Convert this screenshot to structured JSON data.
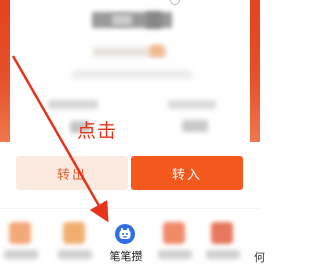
{
  "annotation": {
    "text": "点击"
  },
  "actions": {
    "transfer_out_label": "转出",
    "transfer_in_label": "转入"
  },
  "bottom_nav": {
    "active_label": "笔笔攒",
    "partial_right_char": "何"
  },
  "colors": {
    "header_red": "#e3431e",
    "primary_orange": "#f4581d",
    "annotation_red": "#e8331c",
    "active_tab_blue": "#2f6fe3"
  }
}
